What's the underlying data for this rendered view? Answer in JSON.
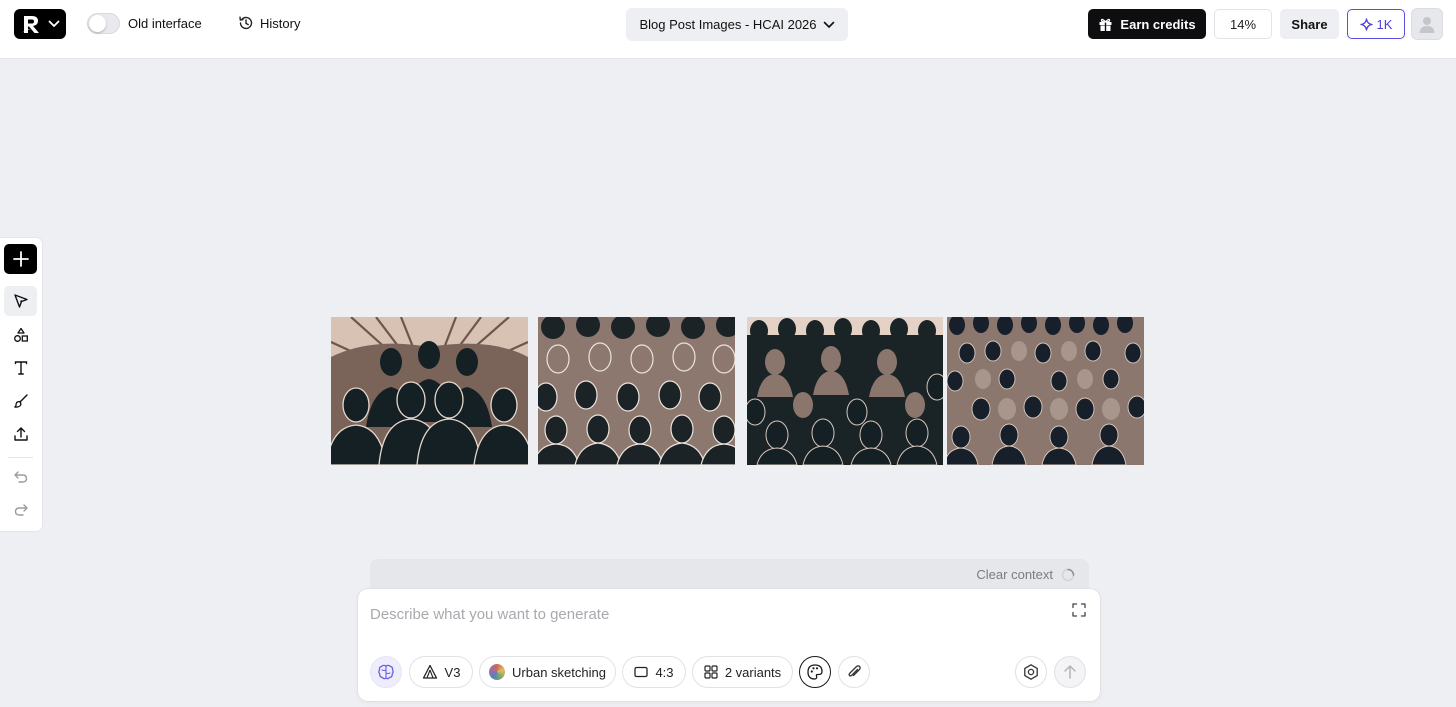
{
  "topbar": {
    "old_interface_label": "Old interface",
    "old_interface_on": false,
    "history_label": "History",
    "project_title": "Blog Post Images - HCAI 2026",
    "earn_credits_label": "Earn credits",
    "zoom_level": "14%",
    "share_label": "Share",
    "credits_label": "1K"
  },
  "toolbar": {
    "tools": [
      "add",
      "select",
      "shapes",
      "text",
      "brush",
      "upload",
      "undo",
      "redo"
    ],
    "active_tool": "select"
  },
  "canvas": {
    "images": [
      {
        "name": "crowd-sunburst-profiles"
      },
      {
        "name": "crowd-outlined-faces"
      },
      {
        "name": "crowd-dark-figures"
      },
      {
        "name": "crowd-dense-figures"
      }
    ]
  },
  "context": {
    "clear_label": "Clear context"
  },
  "prompt": {
    "placeholder": "Describe what you want to generate",
    "value": "",
    "model_label": "V3",
    "style_label": "Urban sketching",
    "aspect_label": "4:3",
    "variants_label": "2 variants"
  },
  "colors": {
    "accent": "#4b3fd6",
    "dark": "#0e0e10",
    "canvas_bg": "#eeeff2",
    "image_tan": "#d9c4b6",
    "image_taupe": "#8a766d",
    "image_ink": "#142024"
  }
}
